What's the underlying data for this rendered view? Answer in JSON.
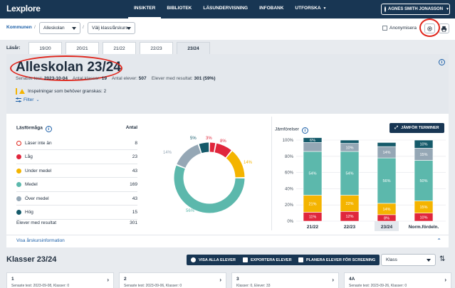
{
  "app": {
    "logo": "Lexplore",
    "nav": [
      "INSIKTER",
      "BIBLIOTEK",
      "LÄSUNDERVISNING",
      "INFOBANK",
      "UTFORSKA"
    ],
    "user": "AGNES SMITH JONASSON"
  },
  "filters": {
    "breadcrumb": "Kommunen",
    "school": "Alleskolan",
    "class_placeholder": "Välj klass/årskurs",
    "anonymize": "Anonymisera"
  },
  "tabs": {
    "label": "Läsår:",
    "items": [
      "19/20",
      "20/21",
      "21/22",
      "22/23",
      "23/24"
    ],
    "active": "23/24"
  },
  "school": {
    "title": "Alleskolan 23/24",
    "last_test_label": "Senaste test:",
    "last_test": "2023-10-04",
    "classes_label": "Antal klasser:",
    "classes": "19",
    "students_label": "Antal elever:",
    "students": "507",
    "results_label": "Elever med resultat:",
    "results": "301 (59%)",
    "warning": "Inspelningar som behöver granskas: 2",
    "filter": "Filter"
  },
  "table": {
    "header_left": "Läsförmåga",
    "header_right": "Antal",
    "rows": [
      {
        "label": "Läser inte än",
        "value": "8",
        "color": "#ffffff",
        "border": "#e0261c"
      },
      {
        "label": "Låg",
        "value": "23",
        "color": "#e0263c",
        "border": "#e0263c"
      },
      {
        "label": "Under medel",
        "value": "43",
        "color": "#f4b400",
        "border": "#f4b400"
      },
      {
        "label": "Medel",
        "value": "169",
        "color": "#5cb8ac",
        "border": "#5cb8ac"
      },
      {
        "label": "Över medel",
        "value": "43",
        "color": "#95a7b5",
        "border": "#95a7b5"
      },
      {
        "label": "Hög",
        "value": "15",
        "color": "#155a6a",
        "border": "#155a6a"
      }
    ],
    "total_label": "Elever med resultat",
    "total_value": "301"
  },
  "donut": {
    "labels": [
      "3%",
      "8%",
      "14%",
      "56%",
      "14%",
      "5%"
    ],
    "values": [
      3,
      8,
      14,
      56,
      14,
      5
    ],
    "colors": [
      "#e0263c",
      "#e0263c",
      "#f4b400",
      "#5cb8ac",
      "#95a7b5",
      "#155a6a"
    ]
  },
  "compare": {
    "label": "Jämförelser",
    "button": "JÄMFÖR TERMINER"
  },
  "chart_data": {
    "type": "bar",
    "stacked": true,
    "categories": [
      "21/22",
      "22/23",
      "23/24",
      "Norm.fördeln."
    ],
    "yticks": [
      "0%",
      "20%",
      "40%",
      "60%",
      "80%",
      "100%"
    ],
    "ylim": [
      0,
      100
    ],
    "series": [
      {
        "values": [
          11,
          12,
          8,
          10
        ],
        "color": "#e0263c",
        "labels": [
          "11%",
          "12%",
          "8%",
          "10%"
        ]
      },
      {
        "values": [
          21,
          20,
          14,
          15
        ],
        "color": "#f4b400",
        "labels": [
          "21%",
          "22%",
          "14%",
          "15%"
        ]
      },
      {
        "values": [
          54,
          54,
          56,
          50
        ],
        "color": "#5cb8ac",
        "labels": [
          "54%",
          "54%",
          "56%",
          "50%"
        ]
      },
      {
        "values": [
          11,
          10,
          14,
          15
        ],
        "color": "#95a7b5",
        "labels": [
          "",
          "10%",
          "14%",
          "15%"
        ]
      },
      {
        "values": [
          6,
          4,
          5,
          10
        ],
        "color": "#155a6a",
        "labels": [
          "6%",
          "",
          "",
          "10%"
        ]
      }
    ],
    "highlight": "23/24"
  },
  "footer_link": "Visa årskursinformation",
  "classes": {
    "title": "Klasser 23/24",
    "buttons": [
      "VISA ALLA ELEVER",
      "EXPORTERA ELEVER",
      "PLANERA ELEVER FÖR SCREENING"
    ],
    "select": "Klass",
    "cards": [
      {
        "num": "1",
        "sub": "Senaste test: 2023-09-08, Klasser: 0"
      },
      {
        "num": "2",
        "sub": "Senaste test: 2023-09-06, Klasser: 0"
      },
      {
        "num": "3",
        "sub": "Klasser: 0, Elever: 33"
      },
      {
        "num": "4A",
        "sub": "Senaste test: 2023-09-26, Klasser: 0"
      }
    ]
  }
}
